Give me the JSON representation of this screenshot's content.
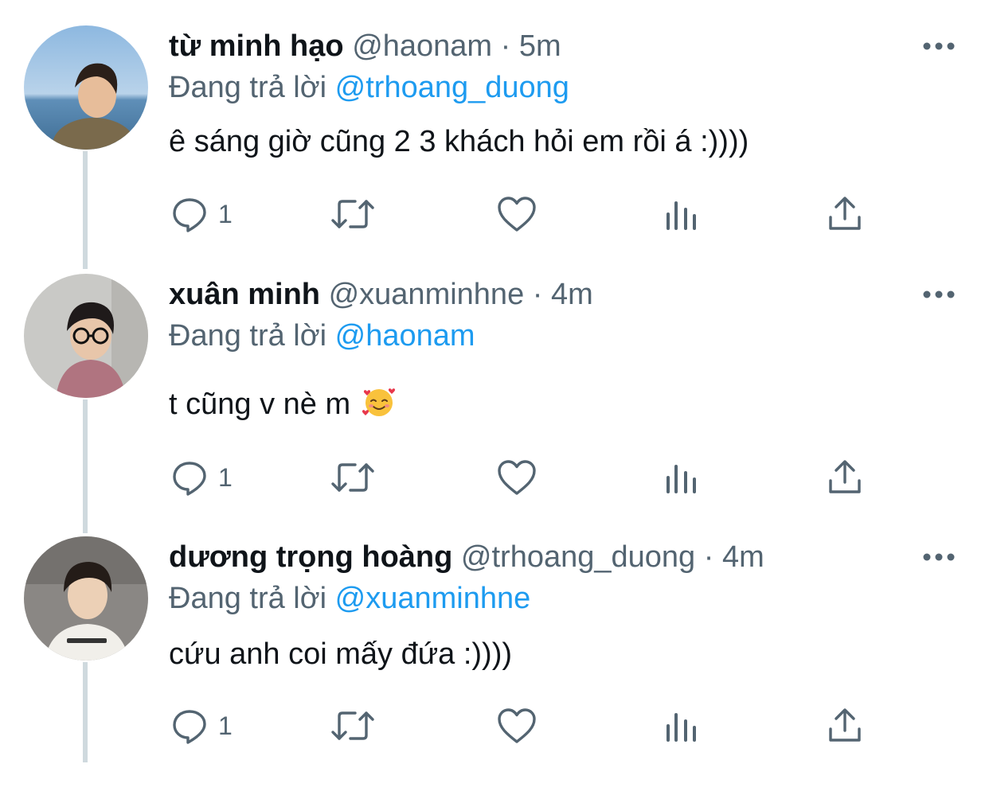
{
  "thread": {
    "tweets": [
      {
        "name": "từ minh hạo",
        "handle": "@haonam",
        "separator": "·",
        "time": "5m",
        "reply_prefix": "Đang trả lời",
        "reply_to": "@trhoang_duong",
        "text": "ê sáng giờ cũng 2 3 khách hỏi em rồi á :))))",
        "reply_count": "1"
      },
      {
        "name": "xuân minh",
        "handle": "@xuanminhne",
        "separator": "·",
        "time": "4m",
        "reply_prefix": "Đang trả lời",
        "reply_to": "@haonam",
        "text": "t cũng v nè m",
        "emoji": "smiling-face-with-hearts",
        "reply_count": "1"
      },
      {
        "name": "dương trọng hoàng",
        "handle": "@trhoang_duong",
        "separator": "·",
        "time": "4m",
        "reply_prefix": "Đang trả lời",
        "reply_to": "@xuanminhne",
        "text": "cứu anh coi mấy đứa :))))",
        "reply_count": "1"
      }
    ]
  },
  "icons": [
    "reply-icon",
    "retweet-icon",
    "like-icon",
    "analytics-icon",
    "share-icon",
    "more-icon"
  ],
  "colors": {
    "text": "#0f1419",
    "secondary": "#536471",
    "link": "#1d9bf0",
    "thread_line": "#cfd9de"
  }
}
